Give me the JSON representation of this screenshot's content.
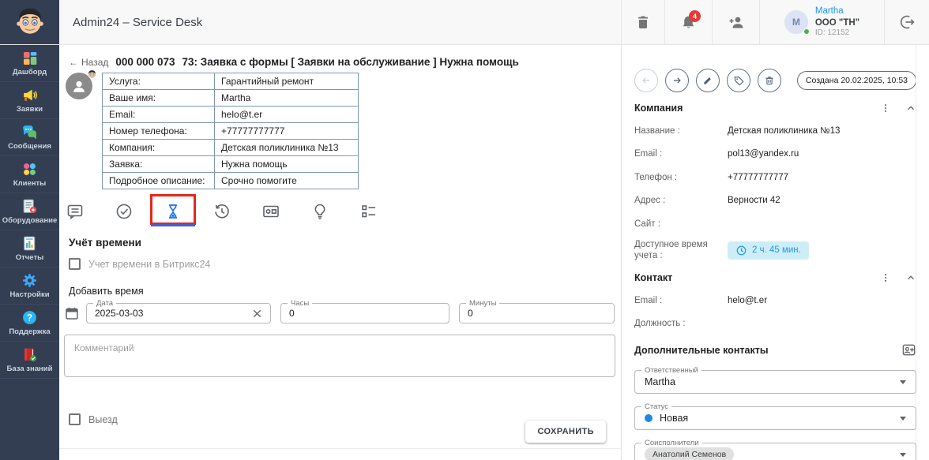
{
  "app": {
    "title": "Admin24 – Service Desk"
  },
  "topbar": {
    "notification_count": "4",
    "user": {
      "name": "Martha",
      "company": "ООО \"ТН\"",
      "user_id": "ID: 12152",
      "avatar_initial": "M"
    }
  },
  "sidebar": {
    "items": [
      {
        "label": "Дашборд",
        "icon": "dashboard-icon"
      },
      {
        "label": "Заявки",
        "icon": "megaphone-icon"
      },
      {
        "label": "Сообщения",
        "icon": "chat-icon"
      },
      {
        "label": "Клиенты",
        "icon": "clients-icon"
      },
      {
        "label": "Оборудование",
        "icon": "equipment-icon"
      },
      {
        "label": "Отчеты",
        "icon": "report-icon"
      },
      {
        "label": "Настройки",
        "icon": "gear-icon"
      },
      {
        "label": "Поддержка",
        "icon": "question-icon"
      },
      {
        "label": "База знаний",
        "icon": "book-icon"
      }
    ]
  },
  "ticket": {
    "back_label": "Назад",
    "number": "000 000 073",
    "title": "73: Заявка с формы [ Заявки на обслуживание ] Нужна помощь",
    "form_fields": [
      {
        "label": "Услуга:",
        "value": "Гарантийный ремонт"
      },
      {
        "label": "Ваше имя:",
        "value": "Martha"
      },
      {
        "label": "Email:",
        "value": "helo@t.er"
      },
      {
        "label": "Номер телефона:",
        "value": "+77777777777"
      },
      {
        "label": "Компания:",
        "value": "Детская поликлиника №13"
      },
      {
        "label": "Заявка:",
        "value": "Нужна помощь"
      },
      {
        "label": "Подробное описание:",
        "value": "Срочно помогите"
      }
    ]
  },
  "tabs": {
    "icons": [
      "comment-icon",
      "check-circle-icon",
      "hourglass-icon",
      "history-icon",
      "equipment-card-icon",
      "lightbulb-icon",
      "checklist-icon"
    ],
    "active": "hourglass-icon"
  },
  "time_tracking": {
    "heading": "Учёт времени",
    "bitrix_checkbox": "Учет времени в Битрикс24",
    "add_time_label": "Добавить время",
    "date_label": "Дата",
    "date_value": "2025-03-03",
    "hours_label": "Часы",
    "hours_value": "0",
    "minutes_label": "Минуты",
    "minutes_value": "0",
    "comment_placeholder": "Комментарий",
    "trip_checkbox": "Выезд",
    "save_button": "СОХРАНИТЬ"
  },
  "details": {
    "created_badge": "Создана 20.02.2025, 10:53",
    "company": {
      "heading": "Компания",
      "fields": [
        {
          "label": "Название :",
          "value": "Детская поликлиника №13"
        },
        {
          "label": "Email :",
          "value": "pol13@yandex.ru"
        },
        {
          "label": "Телефон :",
          "value": "+77777777777"
        },
        {
          "label": "Адрес :",
          "value": "Верности 42"
        },
        {
          "label": "Сайт :",
          "value": ""
        }
      ],
      "available_time_label": "Доступное время учета :",
      "available_time_value": "2 ч. 45 мин."
    },
    "contact": {
      "heading": "Контакт",
      "fields": [
        {
          "label": "Email :",
          "value": "helo@t.er"
        },
        {
          "label": "Должность :",
          "value": ""
        }
      ]
    },
    "additional_contacts_heading": "Дополнительные контакты",
    "responsible_label": "Ответственный",
    "responsible_value": "Martha",
    "status_label": "Статус",
    "status_value": "Новая",
    "coexecutors_label": "Соисполнители",
    "coexecutors_value": "Анатолий Семенов"
  },
  "colors": {
    "accent_blue": "#2196f3",
    "badge_red": "#e53935",
    "sidebar_bg": "#333e52",
    "annotation_red": "#e8251c",
    "time_badge_bg": "#cdeef6",
    "status_dot": "#1e88e5",
    "active_tab_blue": "#1a73e8",
    "table_border": "#8097b3"
  }
}
